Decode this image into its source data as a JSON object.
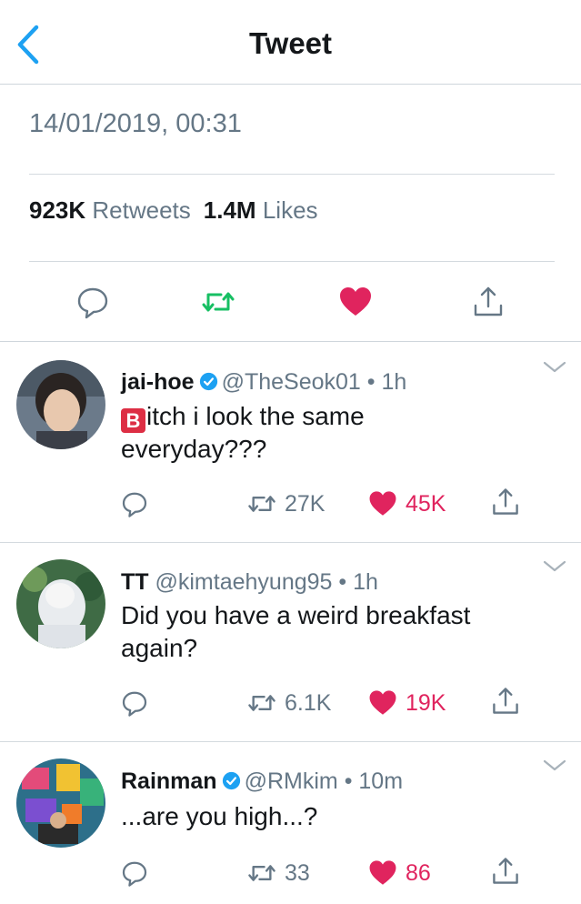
{
  "header": {
    "title": "Tweet",
    "back_icon": "chevron-left-icon"
  },
  "tweet": {
    "timestamp": "14/01/2019, 00:31",
    "retweets_count": "923K",
    "retweets_label": "Retweets",
    "likes_count": "1.4M",
    "likes_label": "Likes"
  },
  "colors": {
    "accent": "#1da1f2",
    "retweet_green": "#17bf63",
    "like_red": "#e0245e",
    "muted": "#657786"
  },
  "replies": [
    {
      "name": "jai-hoe",
      "verified": true,
      "handle": "@TheSeok01",
      "separator": "•",
      "time": "1h",
      "emoji": "B",
      "text_line1": "itch i look the same",
      "text_line2": "everyday???",
      "retweets": "27K",
      "likes": "45K"
    },
    {
      "name": "TT",
      "verified": false,
      "handle": "@kimtaehyung95",
      "separator": "•",
      "time": "1h",
      "text_line1": "Did you have a weird breakfast",
      "text_line2": "again?",
      "retweets": "6.1K",
      "likes": "19K"
    },
    {
      "name": "Rainman",
      "verified": true,
      "handle": "@RMkim",
      "separator": "•",
      "time": "10m",
      "text_line1": "...are you high...?",
      "retweets": "33",
      "likes": "86"
    }
  ]
}
